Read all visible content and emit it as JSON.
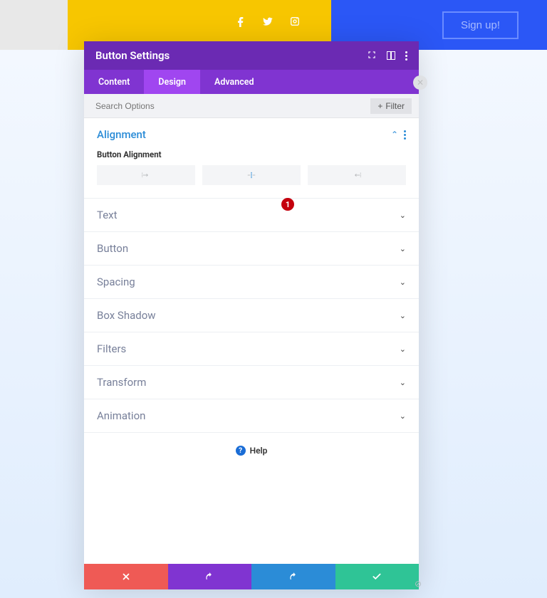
{
  "topbar": {
    "signup_label": "Sign up!"
  },
  "modal": {
    "title": "Button Settings",
    "tabs": {
      "content": "Content",
      "design": "Design",
      "advanced": "Advanced"
    },
    "search_placeholder": "Search Options",
    "filter_label": "Filter"
  },
  "alignment": {
    "title": "Alignment",
    "sub_label": "Button Alignment",
    "badge": "1"
  },
  "sections": {
    "text": "Text",
    "button": "Button",
    "spacing": "Spacing",
    "box_shadow": "Box Shadow",
    "filters": "Filters",
    "transform": "Transform",
    "animation": "Animation"
  },
  "help_label": "Help"
}
